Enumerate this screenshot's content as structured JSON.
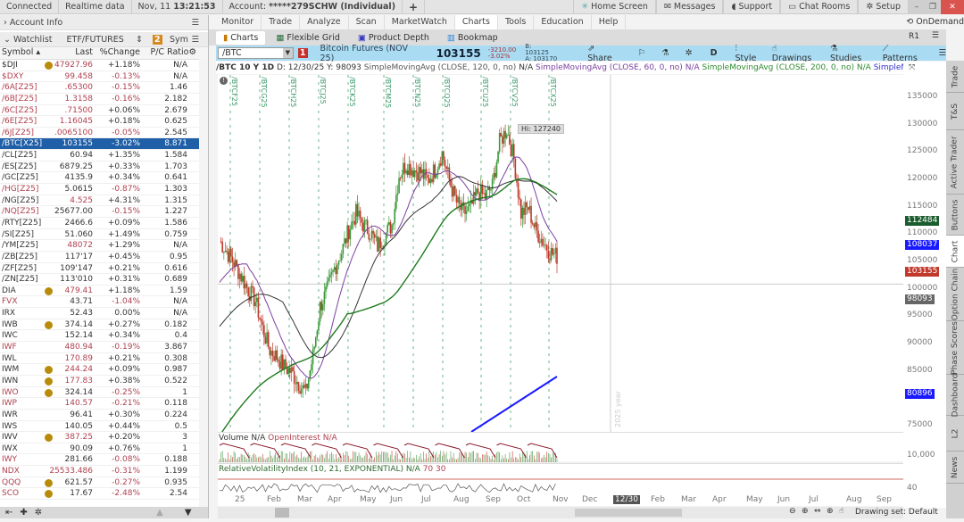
{
  "topbar": {
    "connected": "Connected",
    "realtime": "Realtime data",
    "date": "Nov, 11",
    "time": "13:21:53",
    "account_label": "Account:",
    "account": "*****279SCHW (Individual)",
    "add": "+",
    "home": "Home Screen",
    "messages": "Messages",
    "support": "Support",
    "chat": "Chat Rooms",
    "setup": "Setup"
  },
  "left": {
    "account_info": "Account Info",
    "watchlist": "Watchlist",
    "watchlist_name": "ETF/FUTURES",
    "sym_label": "Sym",
    "link_num": "2",
    "columns": [
      "Symbol",
      "Last",
      "%Change",
      "P/C Ratio"
    ],
    "rows": [
      {
        "sym": "$DJI",
        "last": "47927.96",
        "chg": "+1.18%",
        "pc": "N/A",
        "f": "l",
        "badge": "$"
      },
      {
        "sym": "$DXY",
        "last": "99.458",
        "chg": "-0.13%",
        "pc": "N/A",
        "f": "sl"
      },
      {
        "sym": "/6A[Z25]",
        "last": ".65300",
        "chg": "-0.15%",
        "pc": "1.46",
        "f": "sl"
      },
      {
        "sym": "/6B[Z25]",
        "last": "1.3158",
        "chg": "-0.16%",
        "pc": "2.182",
        "f": "sl"
      },
      {
        "sym": "/6C[Z25]",
        "last": ".71500",
        "chg": "+0.06%",
        "pc": "2.679",
        "f": "sl"
      },
      {
        "sym": "/6E[Z25]",
        "last": "1.16045",
        "chg": "+0.18%",
        "pc": "0.625",
        "f": "sl"
      },
      {
        "sym": "/6J[Z25]",
        "last": ".0065100",
        "chg": "-0.05%",
        "pc": "2.545",
        "f": "sl"
      },
      {
        "sym": "/BTC[X25]",
        "last": "103155",
        "chg": "-3.02%",
        "pc": "8.871",
        "f": "",
        "sel": true
      },
      {
        "sym": "/CL[Z25]",
        "last": "60.94",
        "chg": "+1.35%",
        "pc": "1.584",
        "f": ""
      },
      {
        "sym": "/ES[Z25]",
        "last": "6879.25",
        "chg": "+0.33%",
        "pc": "1.703",
        "f": ""
      },
      {
        "sym": "/GC[Z25]",
        "last": "4135.9",
        "chg": "+0.34%",
        "pc": "0.641",
        "f": ""
      },
      {
        "sym": "/HG[Z25]",
        "last": "5.0615",
        "chg": "-0.87%",
        "pc": "1.303",
        "f": "s"
      },
      {
        "sym": "/NG[Z25]",
        "last": "4.525",
        "chg": "+4.31%",
        "pc": "1.315",
        "f": "l"
      },
      {
        "sym": "/NQ[Z25]",
        "last": "25677.00",
        "chg": "-0.15%",
        "pc": "1.227",
        "f": "s"
      },
      {
        "sym": "/RTY[Z25]",
        "last": "2466.6",
        "chg": "+0.09%",
        "pc": "1.586",
        "f": ""
      },
      {
        "sym": "/SI[Z25]",
        "last": "51.060",
        "chg": "+1.49%",
        "pc": "0.759",
        "f": ""
      },
      {
        "sym": "/YM[Z25]",
        "last": "48072",
        "chg": "+1.29%",
        "pc": "N/A",
        "f": "l"
      },
      {
        "sym": "/ZB[Z25]",
        "last": "117'17",
        "chg": "+0.45%",
        "pc": "0.95",
        "f": ""
      },
      {
        "sym": "/ZF[Z25]",
        "last": "109'147",
        "chg": "+0.21%",
        "pc": "0.616",
        "f": ""
      },
      {
        "sym": "/ZN[Z25]",
        "last": "113'010",
        "chg": "+0.31%",
        "pc": "0.689",
        "f": ""
      },
      {
        "sym": "DIA",
        "last": "479.41",
        "chg": "+1.18%",
        "pc": "1.59",
        "f": "l",
        "badge": "E"
      },
      {
        "sym": "FVX",
        "last": "43.71",
        "chg": "-1.04%",
        "pc": "N/A",
        "f": "s"
      },
      {
        "sym": "IRX",
        "last": "52.43",
        "chg": "0.00%",
        "pc": "N/A",
        "f": ""
      },
      {
        "sym": "IWB",
        "last": "374.14",
        "chg": "+0.27%",
        "pc": "0.182",
        "f": "",
        "badge": "E"
      },
      {
        "sym": "IWC",
        "last": "152.14",
        "chg": "+0.34%",
        "pc": "0.4",
        "f": ""
      },
      {
        "sym": "IWF",
        "last": "480.94",
        "chg": "-0.19%",
        "pc": "3.867",
        "f": "sl"
      },
      {
        "sym": "IWL",
        "last": "170.89",
        "chg": "+0.21%",
        "pc": "0.308",
        "f": "l"
      },
      {
        "sym": "IWM",
        "last": "244.24",
        "chg": "+0.09%",
        "pc": "0.987",
        "f": "l",
        "badge": "E"
      },
      {
        "sym": "IWN",
        "last": "177.83",
        "chg": "+0.38%",
        "pc": "0.522",
        "f": "l",
        "badge": "E"
      },
      {
        "sym": "IWO",
        "last": "324.14",
        "chg": "-0.25%",
        "pc": "1",
        "f": "s",
        "badge": "E"
      },
      {
        "sym": "IWP",
        "last": "140.57",
        "chg": "-0.21%",
        "pc": "0.118",
        "f": "sl"
      },
      {
        "sym": "IWR",
        "last": "96.41",
        "chg": "+0.30%",
        "pc": "0.224",
        "f": ""
      },
      {
        "sym": "IWS",
        "last": "140.05",
        "chg": "+0.44%",
        "pc": "0.5",
        "f": ""
      },
      {
        "sym": "IWV",
        "last": "387.25",
        "chg": "+0.20%",
        "pc": "3",
        "f": "l",
        "badge": "E"
      },
      {
        "sym": "IWX",
        "last": "90.09",
        "chg": "+0.76%",
        "pc": "1",
        "f": ""
      },
      {
        "sym": "IWY",
        "last": "281.66",
        "chg": "-0.08%",
        "pc": "0.188",
        "f": "s"
      },
      {
        "sym": "NDX",
        "last": "25533.486",
        "chg": "-0.31%",
        "pc": "1.199",
        "f": "sl"
      },
      {
        "sym": "QQQ",
        "last": "621.57",
        "chg": "-0.27%",
        "pc": "0.935",
        "f": "s",
        "badge": "E"
      },
      {
        "sym": "SCO",
        "last": "17.67",
        "chg": "-2.48%",
        "pc": "2.54",
        "f": "s",
        "badge": "E"
      }
    ]
  },
  "main": {
    "tabs": [
      "Monitor",
      "Trade",
      "Analyze",
      "Scan",
      "MarketWatch",
      "Charts",
      "Tools",
      "Education",
      "Help"
    ],
    "active_tab": "Charts",
    "ondemand": "OnDemand",
    "subtabs": [
      "Charts",
      "Flexible Grid",
      "Product Depth",
      "Bookmap"
    ],
    "r1": "R1"
  },
  "toolbar": {
    "symbol": "/BTC",
    "link": "1",
    "desc": "Bitcoin Futures (NOV 25)",
    "price": "103155",
    "chg": "-3210.00",
    "chg_pct": "-3.02%",
    "bid": "B: 103125",
    "ask": "A: 103170",
    "share": "Share",
    "period": "D",
    "style": "Style",
    "drawings": "Drawings",
    "studies": "Studies",
    "patterns": "Patterns"
  },
  "studyhdr": {
    "title": "/BTC 10 Y 1D",
    "d": "D: 12/30/25",
    "y": "Y: 98093",
    "sma120": "SimpleMovingAvg (CLOSE, 120, 0, no)",
    "sma60": "SimpleMovingAvg (CLOSE, 60, 0, no)",
    "sma200": "SimpleMovingAvg (CLOSE, 200, 0, no)",
    "sma_more": "SimpleMovingAvg ...",
    "na": "N/A"
  },
  "chart": {
    "hi_label": "Hi: 127240",
    "year_watermark": "2025 year",
    "contracts": [
      "/BTCF25",
      "/BTCG25",
      "/BTCH25",
      "/BTCJ25",
      "/BTCK25",
      "/BTCM25",
      "/BTCN25",
      "/BTCQ25",
      "/BTCU25",
      "/BTCV25",
      "/BTCX25"
    ],
    "yticks": [
      "135000",
      "130000",
      "125000",
      "120000",
      "115000",
      "110000",
      "105000",
      "100000",
      "95000",
      "90000",
      "85000",
      "80000",
      "75000"
    ],
    "price_labels": [
      {
        "v": "112484",
        "c": "#1a5c2e"
      },
      {
        "v": "108037",
        "c": "#1a1aff"
      },
      {
        "v": "103155",
        "c": "#c0392b"
      },
      {
        "v": "98093",
        "c": "#666666"
      },
      {
        "v": "80896",
        "c": "#1a1aff"
      }
    ],
    "weekly_closes": [
      106000,
      104000,
      102000,
      99500,
      97000,
      95000,
      90000,
      86000,
      84800,
      83000,
      82000,
      80000,
      78300,
      85000,
      94000,
      97000,
      101000,
      104000,
      108000,
      111000,
      109000,
      107600,
      105000,
      107000,
      109000,
      118000,
      120000,
      119000,
      118500,
      117000,
      119000,
      122000,
      117000,
      113000,
      111000,
      112000,
      115000,
      114000,
      116000,
      124000,
      126400,
      121000,
      111000,
      112000,
      108000,
      106000,
      104000,
      103155
    ],
    "volume_label": "Volume",
    "oi_label": "OpenInterest",
    "vol_tick": "10,000",
    "rvi_label": "RelativeVolatilityIndex (10, 21, EXPONENTIAL)",
    "rvi_70": "70",
    "rvi_30": "30",
    "rvi_tick": "40",
    "xlabels": [
      "25",
      "Feb",
      "Mar",
      "Apr",
      "May",
      "Jun",
      "Jul",
      "Aug",
      "Sep",
      "Oct",
      "Nov",
      "Dec",
      "12/30",
      "Feb",
      "Mar",
      "Apr",
      "May",
      "Jun",
      "Jul",
      "Aug",
      "Sep"
    ],
    "drawing_set": "Drawing set: Default"
  },
  "righttabs": [
    "Trade",
    "T&S",
    "Active Trader",
    "Buttons",
    "Chart",
    "Option Chain",
    "Phase Scores",
    "Dashboard",
    "L2",
    "News"
  ]
}
